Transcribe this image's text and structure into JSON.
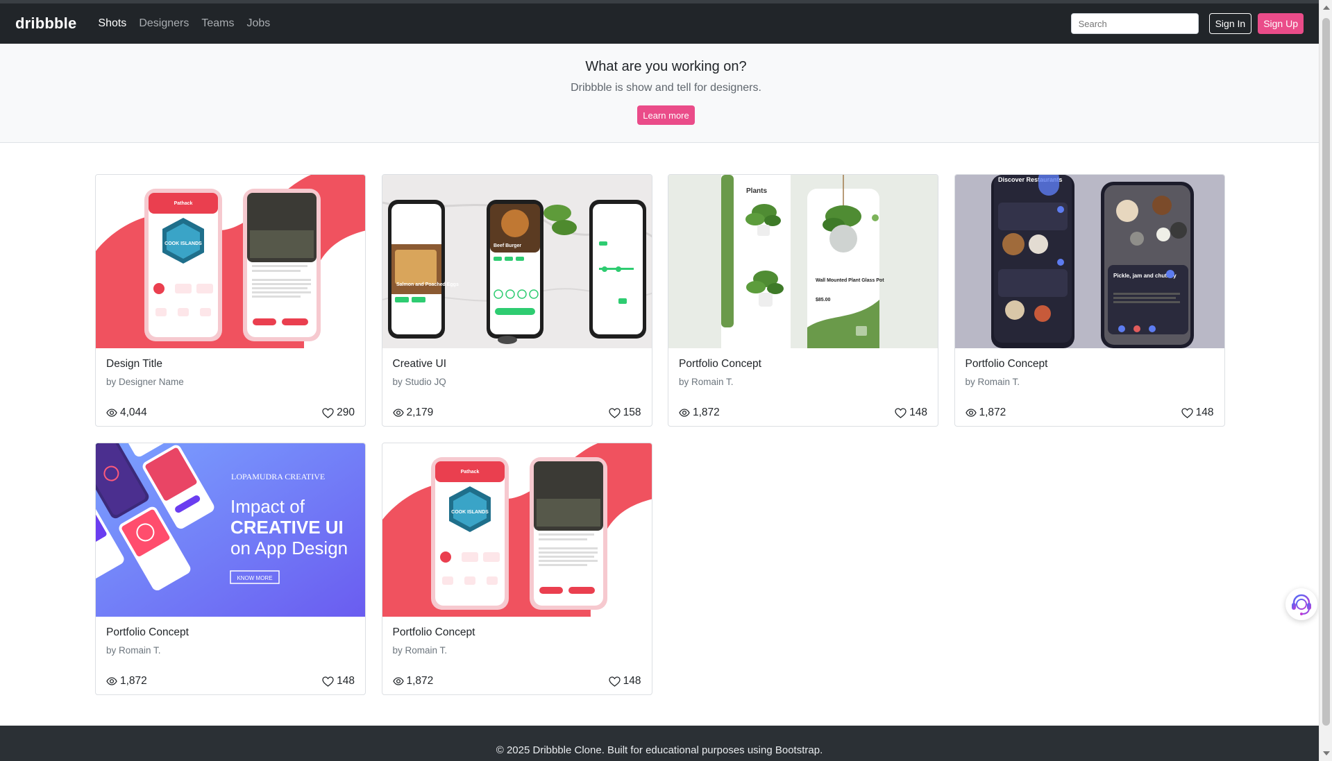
{
  "nav": {
    "brand": "dribbble",
    "links": [
      "Shots",
      "Designers",
      "Teams",
      "Jobs"
    ],
    "search_placeholder": "Search",
    "sign_in": "Sign In",
    "sign_up": "Sign Up"
  },
  "hero": {
    "title": "What are you working on?",
    "subtitle": "Dribbble is show and tell for designers.",
    "button": "Learn more"
  },
  "shots": [
    {
      "title": "Design Title",
      "author": "by Designer Name",
      "views": "4,044",
      "likes": "290",
      "thumb": "travel-app",
      "image_text": [
        "Pathack",
        "COOK ISLANDS"
      ]
    },
    {
      "title": "Creative UI",
      "author": "by Studio JQ",
      "views": "2,179",
      "likes": "158",
      "thumb": "food-app",
      "image_text": [
        "Salmon and Poached Eggs",
        "Beef Burger"
      ]
    },
    {
      "title": "Portfolio Concept",
      "author": "by Romain T.",
      "views": "1,872",
      "likes": "148",
      "thumb": "plant-app",
      "image_text": [
        "Plants",
        "Wall Mounted Plant Glass Pot",
        "$85.00"
      ]
    },
    {
      "title": "Portfolio Concept",
      "author": "by Romain T.",
      "views": "1,872",
      "likes": "148",
      "thumb": "restaurant-app",
      "image_text": [
        "Discover Restaurants",
        "Pickle, jam and chutney"
      ]
    },
    {
      "title": "Portfolio Concept",
      "author": "by Romain T.",
      "views": "1,872",
      "likes": "148",
      "thumb": "creative-ui-banner",
      "image_text": [
        "LOPAMUDRA CREATIVE",
        "Impact of",
        "CREATIVE UI",
        "on App Design",
        "KNOW MORE"
      ]
    },
    {
      "title": "Portfolio Concept",
      "author": "by Romain T.",
      "views": "1,872",
      "likes": "148",
      "thumb": "travel-app",
      "image_text": [
        "Pathack",
        "COOK ISLANDS"
      ]
    }
  ],
  "footer": {
    "text": "© 2025 Dribbble Clone. Built for educational purposes using Bootstrap."
  },
  "colors": {
    "accent": "#ea4c89",
    "navbar": "#212529",
    "footer": "#2b3035"
  },
  "icons": [
    "eye-icon",
    "heart-icon",
    "support-headset-icon"
  ]
}
